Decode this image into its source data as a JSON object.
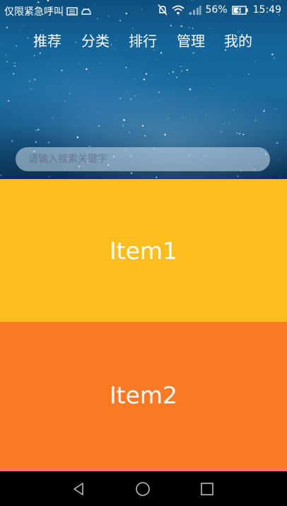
{
  "status_bar": {
    "carrier": "仅限紧急呼叫",
    "battery": "56%",
    "time": "15:49"
  },
  "nav": {
    "tabs": [
      "推荐",
      "分类",
      "排行",
      "管理",
      "我的"
    ]
  },
  "search": {
    "placeholder": "请输入搜索关键字"
  },
  "items": [
    "Item1",
    "Item2"
  ],
  "colors": {
    "item1": "#fbbe1e",
    "item2": "#fc7a23",
    "item3_peek": "#f76b7c"
  },
  "system_nav": {
    "icons": [
      "back-icon",
      "home-icon",
      "recents-icon"
    ]
  }
}
